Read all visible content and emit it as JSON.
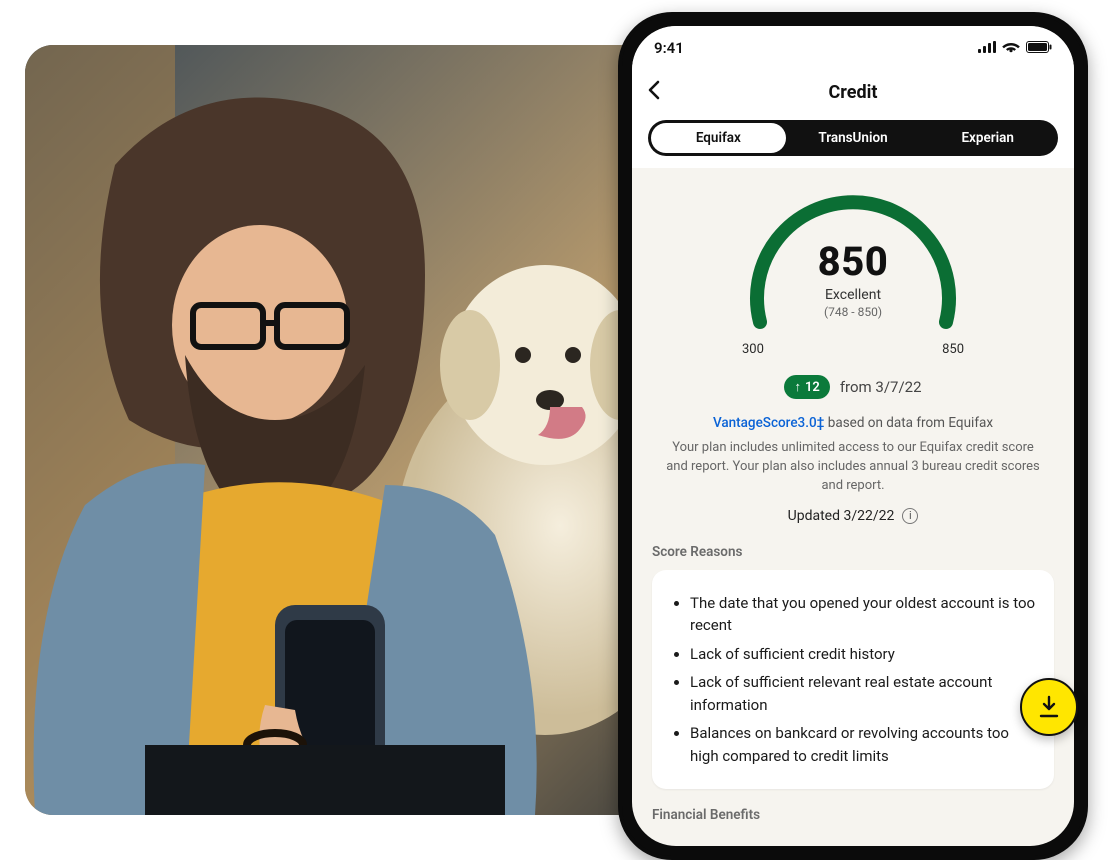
{
  "statusbar": {
    "time": "9:41"
  },
  "nav": {
    "title": "Credit"
  },
  "tabs": {
    "items": [
      {
        "label": "Equifax",
        "active": true
      },
      {
        "label": "TransUnion",
        "active": false
      },
      {
        "label": "Experian",
        "active": false
      }
    ]
  },
  "gauge": {
    "score": "850",
    "rating": "Excellent",
    "range": "(748 - 850)",
    "min": "300",
    "max": "850",
    "color": "#0b6e34"
  },
  "change": {
    "direction_icon": "↑",
    "delta": "12",
    "from_label": "from 3/7/22"
  },
  "vantage": {
    "link_text": "VantageScore3.0‡",
    "tail_text": "  based on data from Equifax"
  },
  "plan_copy": "Your plan includes unlimited access to our Equifax credit score and report. Your plan also includes annual 3 bureau credit scores and report.",
  "updated": {
    "label": "Updated 3/22/22"
  },
  "sections": {
    "score_reasons_label": "Score Reasons",
    "financial_benefits_label": "Financial Benefits"
  },
  "score_reasons": [
    "The date that you opened your oldest account is too recent",
    "Lack of sufficient credit history",
    "Lack of sufficient relevant real estate account information",
    "Balances on bankcard or revolving accounts too high compared to credit limits"
  ],
  "photo_alt": "Bearded man with glasses holding a phone next to a yellow Labrador dog"
}
